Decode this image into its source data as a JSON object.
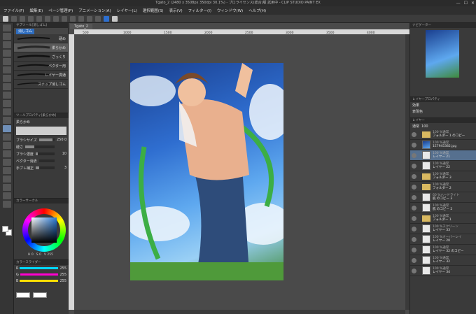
{
  "window": {
    "title": "Tgato_2 (2480 x 3508px 350dpi 30.1%) - プロライセンス(総合)版 試用中 - CLIP STUDIO PAINT EX",
    "controls": [
      "—",
      "☐",
      "✕"
    ]
  },
  "menu": [
    "ファイル(F)",
    "編集(E)",
    "ページ管理(P)",
    "アニメーション(A)",
    "レイヤー(L)",
    "選択範囲(S)",
    "表示(V)",
    "フィルター(I)",
    "ウィンドウ(W)",
    "ヘルプ(H)"
  ],
  "subtool": {
    "panel_title": "サブツール[消しゴム]",
    "active_tab": "消しゴム",
    "brushes": [
      {
        "label": "硬め"
      },
      {
        "label": "柔らかめ"
      },
      {
        "label": "ざっくり"
      },
      {
        "label": "ベクター用"
      },
      {
        "label": "レイヤー貫通"
      },
      {
        "label": "スナップ消しゴム"
      }
    ]
  },
  "toolprop": {
    "panel_title": "ツールプロパティ[柔らかめ]",
    "preset_name": "柔らかめ",
    "rows": [
      {
        "label": "ブラシサイズ",
        "value": "250.0",
        "fill": 0.85
      },
      {
        "label": "硬さ",
        "value": "",
        "fill": 0.3
      },
      {
        "label": "ブラシ濃度",
        "value": "10",
        "fill": 0.1
      },
      {
        "label": "ベクター消去",
        "value": "",
        "fill": 0.0
      },
      {
        "label": "手ブレ補正",
        "value": "3",
        "fill": 0.2
      }
    ]
  },
  "colorwheel": {
    "panel_title": "カラーサークル",
    "values": [
      "H 0",
      "S 0",
      "V 255"
    ]
  },
  "colorslider": {
    "panel_title": "カラースライダー",
    "channels": [
      {
        "name": "R",
        "value": "255",
        "color": "#00d8ff"
      },
      {
        "name": "G",
        "value": "255",
        "color": "#ff00d0"
      },
      {
        "name": "B",
        "value": "255",
        "color": "#ffe000"
      }
    ]
  },
  "canvas": {
    "doc_tab": "Tgato_2",
    "ruler_marks": [
      "500",
      "1000",
      "1500",
      "2000",
      "2500",
      "3000",
      "3500",
      "4000"
    ]
  },
  "navigator": {
    "panel_title": "ナビゲーター"
  },
  "layerprop": {
    "panel_title": "レイヤープロパティ",
    "effect_label": "効果",
    "color_label": "表現色"
  },
  "layers": {
    "panel_title": "レイヤー",
    "blend_mode": "通常",
    "opacity": "100",
    "items": [
      {
        "mode": "100 %通常",
        "name": "フォルダー 1 のコピー",
        "type": "folder"
      },
      {
        "mode": "100 %通常",
        "name": "1E7945382.jpg",
        "type": "image"
      },
      {
        "mode": "100 %通常",
        "name": "レイヤー 21",
        "type": "layer",
        "selected": true
      },
      {
        "mode": "100 %通常",
        "name": "レイヤー 22",
        "type": "layer"
      },
      {
        "mode": "100 %通常",
        "name": "フォルダー 3",
        "type": "folder"
      },
      {
        "mode": "100 %通常",
        "name": "フォルダー 2",
        "type": "folder"
      },
      {
        "mode": "60 %ハードライト",
        "name": "肌 のコピー 3",
        "type": "layer"
      },
      {
        "mode": "100 %通常",
        "name": "肌 のコピー 2",
        "type": "layer"
      },
      {
        "mode": "100 %通常",
        "name": "フォルダー 1",
        "type": "folder"
      },
      {
        "mode": "100 %スクリーン",
        "name": "レイヤー 33",
        "type": "layer"
      },
      {
        "mode": "100 %オーバーレイ",
        "name": "レイヤー 20",
        "type": "layer"
      },
      {
        "mode": "100 %通常",
        "name": "レイヤー 32 のコピー",
        "type": "layer"
      },
      {
        "mode": "100 %通常",
        "name": "レイヤー 32",
        "type": "layer"
      },
      {
        "mode": "100 %通常",
        "name": "レイヤー 34",
        "type": "layer"
      }
    ]
  }
}
